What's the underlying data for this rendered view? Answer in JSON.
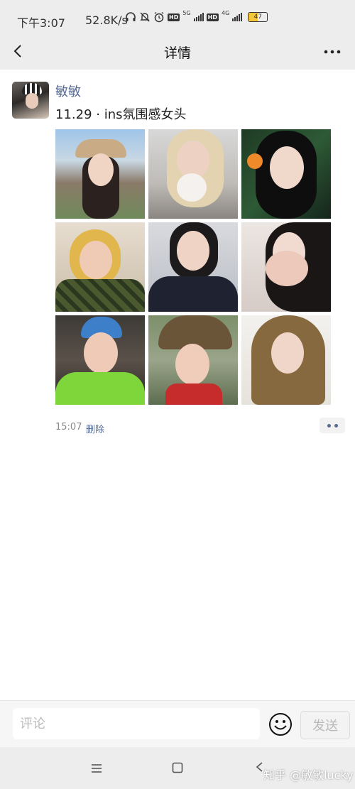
{
  "status_bar": {
    "time": "下午3:07",
    "speed": "52.8K/s",
    "network_5g": "5G",
    "network_4g": "4G",
    "hd": "HD",
    "battery_level": "47",
    "battery_fraction": 0.47,
    "icons": [
      "headphones-icon",
      "mute-icon",
      "alarm-icon",
      "hd-icon",
      "signal-icon",
      "battery-icon"
    ]
  },
  "nav": {
    "title": "详情",
    "back_icon": "back-chevron-icon",
    "more_icon": "more-dots-icon"
  },
  "post": {
    "user_name": "敏敏",
    "text": "11.29 · ins氛围感女头",
    "photo_count": 9,
    "time": "15:07",
    "delete_label": "删除"
  },
  "comment": {
    "placeholder": "评论",
    "value": "",
    "send_label": "发送",
    "emoji_icon": "emoji-icon"
  },
  "system_nav": {
    "menu_icon": "menu-icon",
    "home_icon": "home-square-icon",
    "back_icon": "back-triangle-icon",
    "watermark": "知乎 @敏敏lucky"
  },
  "colors": {
    "link": "#576b95",
    "bar_bg": "#ededed",
    "battery": "#f3c63c"
  }
}
